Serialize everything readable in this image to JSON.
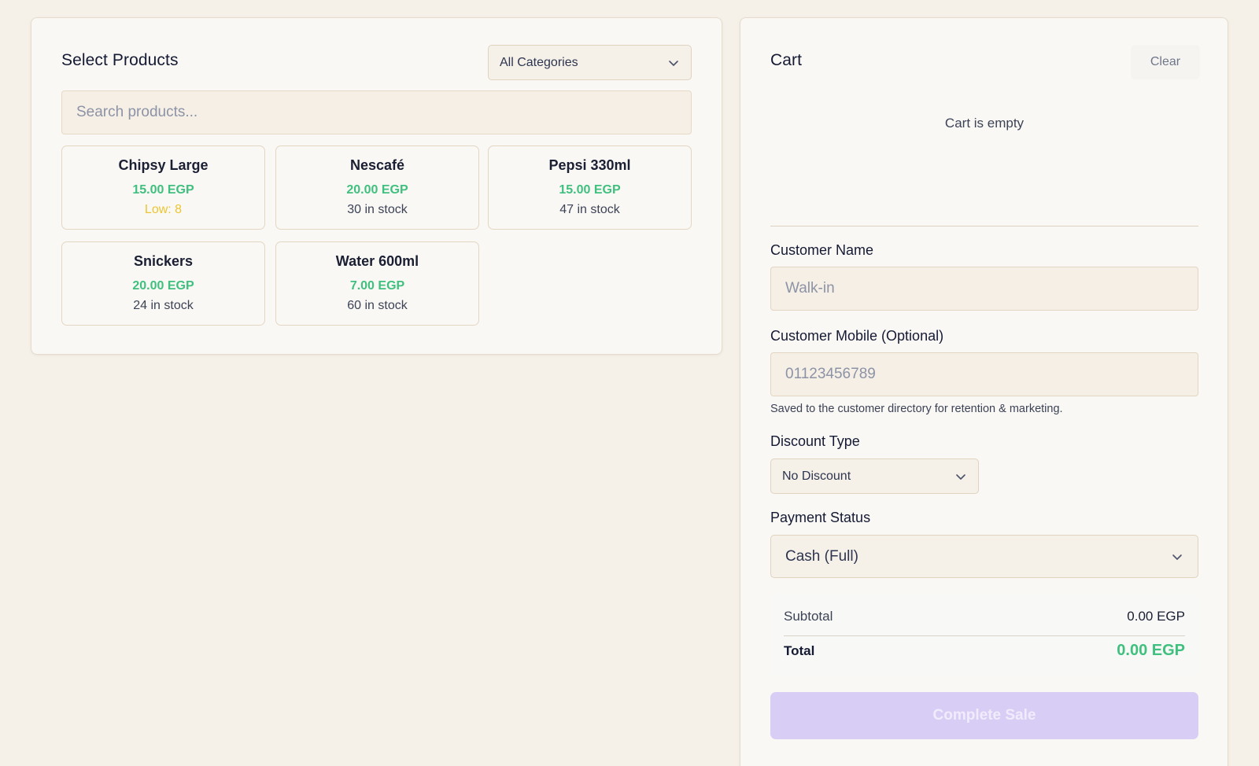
{
  "products_panel": {
    "title": "Select Products",
    "category_select": {
      "value": "All Categories"
    },
    "search": {
      "placeholder": "Search products..."
    },
    "products": [
      {
        "name": "Chipsy Large",
        "price": "15.00 EGP",
        "stock": "Low: 8",
        "low_stock": true
      },
      {
        "name": "Nescafé",
        "price": "20.00 EGP",
        "stock": "30 in stock",
        "low_stock": false
      },
      {
        "name": "Pepsi 330ml",
        "price": "15.00 EGP",
        "stock": "47 in stock",
        "low_stock": false
      },
      {
        "name": "Snickers",
        "price": "20.00 EGP",
        "stock": "24 in stock",
        "low_stock": false
      },
      {
        "name": "Water 600ml",
        "price": "7.00 EGP",
        "stock": "60 in stock",
        "low_stock": false
      }
    ]
  },
  "cart": {
    "title": "Cart",
    "clear_label": "Clear",
    "empty_message": "Cart is empty",
    "customer_name": {
      "label": "Customer Name",
      "placeholder": "Walk-in",
      "value": ""
    },
    "customer_mobile": {
      "label": "Customer Mobile (Optional)",
      "placeholder": "01123456789",
      "value": "",
      "helper": "Saved to the customer directory for retention & marketing."
    },
    "discount_type": {
      "label": "Discount Type",
      "value": "No Discount"
    },
    "payment_status": {
      "label": "Payment Status",
      "value": "Cash (Full)"
    },
    "totals": {
      "subtotal_label": "Subtotal",
      "subtotal_value": "0.00 EGP",
      "total_label": "Total",
      "total_value": "0.00 EGP"
    },
    "complete_sale_label": "Complete Sale"
  },
  "colors": {
    "background": "#f5f0e8",
    "panel": "#faf8f4",
    "price_green": "#3fc07f",
    "low_stock_yellow": "#ecc531",
    "primary_disabled": "#d8cdf5"
  }
}
